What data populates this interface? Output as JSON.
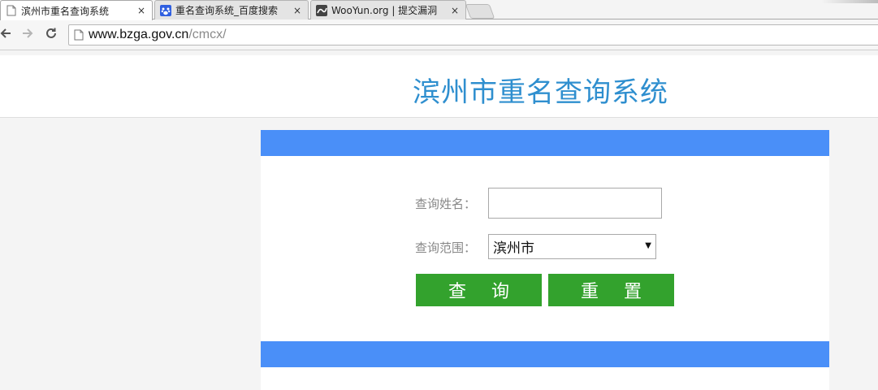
{
  "browser": {
    "tabs": [
      {
        "title": "滨州市重名查询系统",
        "active": true,
        "favicon": "page-icon"
      },
      {
        "title": "重名查询系统_百度搜索",
        "active": false,
        "favicon": "baidu-paw-icon"
      },
      {
        "title": "WooYun.org | 提交漏洞",
        "active": false,
        "favicon": "wooyun-icon"
      }
    ],
    "close_glyph": "×",
    "url": {
      "host": "www.bzga.gov.cn",
      "path": "/cmcx/"
    }
  },
  "page": {
    "title": "滨州市重名查询系统",
    "form": {
      "name_label": "查询姓名：",
      "name_value": "",
      "range_label": "查询范围：",
      "range_selected": "滨州市",
      "select_arrow": "▼",
      "query_button": "查 询",
      "reset_button": "重 置"
    }
  },
  "colors": {
    "title": "#2f8fcf",
    "band": "#4a8ff8",
    "button": "#33a22d"
  }
}
